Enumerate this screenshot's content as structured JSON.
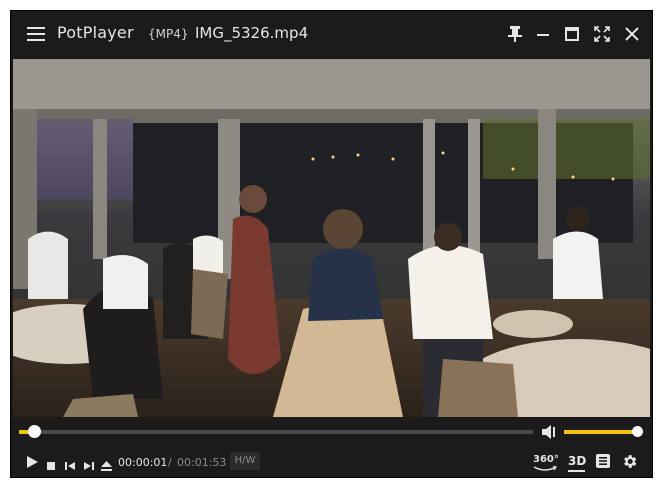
{
  "titlebar": {
    "app_name": "PotPlayer",
    "format": "{MP4}",
    "file_name": "IMG_5326.mp4"
  },
  "playback": {
    "current_time": "00:00:01",
    "separator": "/",
    "total_time": "00:01:53",
    "progress_fraction": 0.009,
    "volume_fraction": 1.0
  },
  "controls": {
    "hw_label": "H/W",
    "vr_label": "360°",
    "threed_label": "3D"
  },
  "colors": {
    "accent": "#f2c40f",
    "background": "#1b1b1b"
  }
}
